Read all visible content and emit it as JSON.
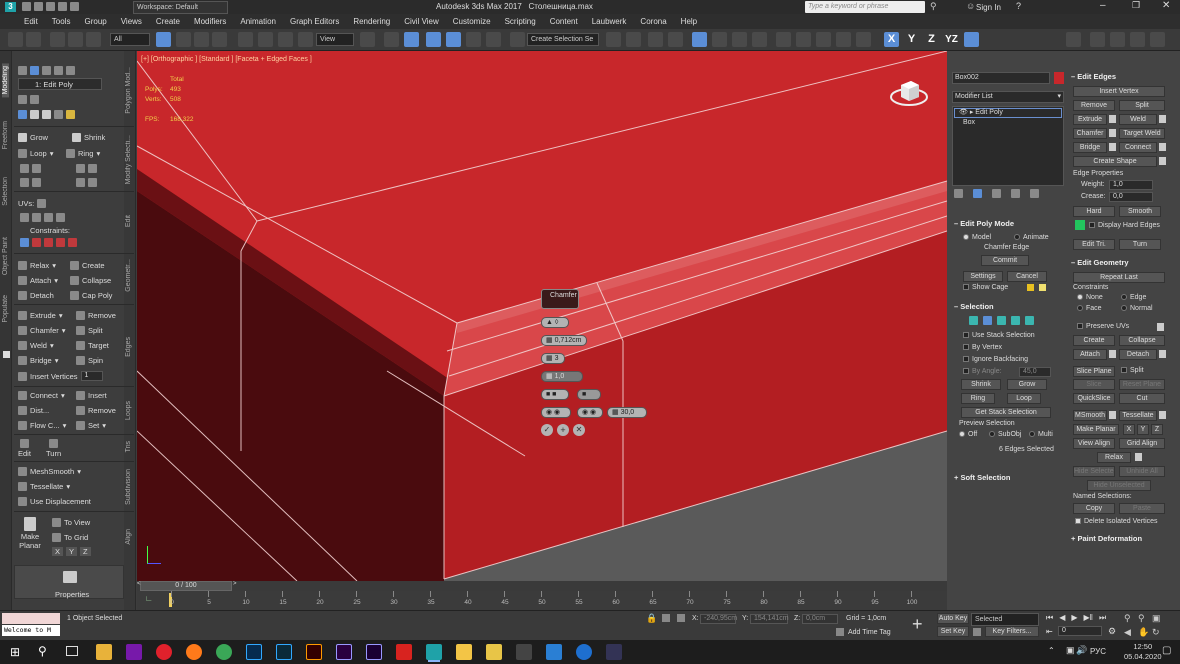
{
  "window": {
    "workspace": "Workspace: Default",
    "title": "Autodesk 3ds Max 2017",
    "file": "Столешница.max",
    "search_placeholder": "Type a keyword or phrase",
    "sign_in": "Sign In"
  },
  "menu": [
    "Edit",
    "Tools",
    "Group",
    "Views",
    "Create",
    "Modifiers",
    "Animation",
    "Graph Editors",
    "Rendering",
    "Civil View",
    "Customize",
    "Scripting",
    "Content",
    "Laubwerk",
    "Corona",
    "Help"
  ],
  "toolbar": {
    "filter": "All",
    "view": "View",
    "selection_set": "Create Selection Se"
  },
  "ribbon": {
    "tabs": [
      "Modeling",
      "Freeform",
      "Selection",
      "Object Paint",
      "Populate"
    ],
    "subtabs": [
      "Polygon Mod...",
      "Modify Selecti...",
      "Edit",
      "Geometr...",
      "Edges",
      "Loops",
      "Tris",
      "Subdivision",
      "Align"
    ],
    "stack_item": "1: Edit Poly",
    "grow": "Grow",
    "shrink": "Shrink",
    "loop": "Loop",
    "ring": "Ring",
    "uvs": "UVs:",
    "constraints": "Constraints:",
    "relax": "Relax",
    "create": "Create",
    "attach": "Attach",
    "collapse": "Collapse",
    "detach": "Detach",
    "cap_poly": "Cap Poly",
    "extrude": "Extrude",
    "remove": "Remove",
    "chamfer": "Chamfer",
    "split": "Split",
    "weld": "Weld",
    "target": "Target",
    "bridge": "Bridge",
    "spin": "Spin",
    "insert_vertices": "Insert Vertices",
    "insert_vertices_value": "1",
    "connect": "Connect",
    "insert": "Insert",
    "dist": "Dist...",
    "remove2": "Remove",
    "flow": "Flow C...",
    "set": "Set",
    "edit": "Edit",
    "turn": "Turn",
    "meshsmooth": "MeshSmooth",
    "tessellate": "Tessellate",
    "use_displacement": "Use Displacement",
    "make_planar": "Make Planar",
    "to_view": "To View",
    "to_grid": "To Grid",
    "x": "X",
    "y": "Y",
    "z": "Z",
    "properties": "Properties"
  },
  "viewport": {
    "label": "[+] [Orthographic ] [Standard ] [Faceta + Edged Faces ]",
    "stats_total": "Total",
    "polys_label": "Polys:",
    "polys_value": "493",
    "verts_label": "Verts:",
    "verts_value": "508",
    "fps_label": "FPS:",
    "fps_value": "168,322",
    "caddy": {
      "title": "Chamfer",
      "amount": "0,712cm",
      "segments": "3",
      "tension": "1,0",
      "depth": "30,0"
    }
  },
  "timeline": {
    "frame": "0 / 100",
    "ticks": [
      "0",
      "5",
      "10",
      "15",
      "20",
      "25",
      "30",
      "35",
      "40",
      "45",
      "50",
      "55",
      "60",
      "65",
      "70",
      "75",
      "80",
      "85",
      "90",
      "95",
      "100"
    ]
  },
  "command_panel": {
    "object_name": "Box002",
    "modifier_list": "Modifier List",
    "stack": [
      "Edit Poly",
      "Box"
    ],
    "edit_poly_mode": "Edit Poly Mode",
    "model": "Model",
    "animate": "Animate",
    "current_op": "Chamfer Edge",
    "commit": "Commit",
    "settings": "Settings",
    "cancel": "Cancel",
    "show_cage": "Show Cage",
    "selection": "Selection",
    "use_stack_selection": "Use Stack Selection",
    "by_vertex": "By Vertex",
    "ignore_backfacing": "Ignore Backfacing",
    "by_angle": "By Angle:",
    "by_angle_value": "45,0",
    "shrink": "Shrink",
    "grow": "Grow",
    "ring": "Ring",
    "loop": "Loop",
    "get_stack_selection": "Get Stack Selection",
    "preview_selection": "Preview Selection",
    "off": "Off",
    "subobj": "SubObj",
    "multi": "Multi",
    "edges_selected": "6 Edges Selected",
    "soft_selection": "Soft Selection"
  },
  "right_panel": {
    "edit_edges": "Edit Edges",
    "insert_vertex": "Insert Vertex",
    "remove": "Remove",
    "split": "Split",
    "extrude": "Extrude",
    "weld": "Weld",
    "chamfer": "Chamfer",
    "target_weld": "Target Weld",
    "bridge": "Bridge",
    "connect": "Connect",
    "create_shape": "Create Shape",
    "edge_properties": "Edge Properties",
    "weight_label": "Weight:",
    "weight_value": "1,0",
    "crease_label": "Crease:",
    "crease_value": "0,0",
    "hard": "Hard",
    "smooth": "Smooth",
    "display_hard_edges": "Display Hard Edges",
    "edit_tri": "Edit Tri.",
    "turn": "Turn",
    "edit_geometry": "Edit Geometry",
    "repeat_last": "Repeat Last",
    "constraints": "Constraints",
    "none": "None",
    "edge": "Edge",
    "face": "Face",
    "normal": "Normal",
    "preserve_uvs": "Preserve UVs",
    "create": "Create",
    "collapse": "Collapse",
    "attach": "Attach",
    "detach": "Detach",
    "slice_plane": "Slice Plane",
    "split2": "Split",
    "slice": "Slice",
    "reset_plane": "Reset Plane",
    "quickslice": "QuickSlice",
    "cut": "Cut",
    "msmooth": "MSmooth",
    "tessellate": "Tessellate",
    "make_planar": "Make Planar",
    "x": "X",
    "y": "Y",
    "z": "Z",
    "view_align": "View Align",
    "grid_align": "Grid Align",
    "relax": "Relax",
    "hide_selected": "Hide Selected",
    "unhide_all": "Unhide All",
    "hide_unselected": "Hide Unselected",
    "named_selections": "Named Selections:",
    "copy": "Copy",
    "paste": "Paste",
    "delete_isolated": "Delete Isolated Vertices",
    "paint_deformation": "Paint Deformation"
  },
  "status": {
    "script": "Welcome to M",
    "selected": "1 Object Selected",
    "x_label": "X:",
    "x_value": "-240,95cm",
    "y_label": "Y:",
    "y_value": "154,141cm",
    "z_label": "Z:",
    "z_value": "0,0cm",
    "grid": "Grid = 1,0cm",
    "add_time_tag": "Add Time Tag",
    "auto_key": "Auto Key",
    "set_key": "Set Key",
    "selected_dd": "Selected",
    "key_filters": "Key Filters...",
    "frame_value": "0"
  },
  "taskbar": {
    "language": "РУС",
    "time": "12:50",
    "date": "05.04.2020"
  },
  "colors": {
    "object_red": "#c8272b",
    "selection": "#5b8ed6",
    "hard_edges": "#22c55e"
  }
}
